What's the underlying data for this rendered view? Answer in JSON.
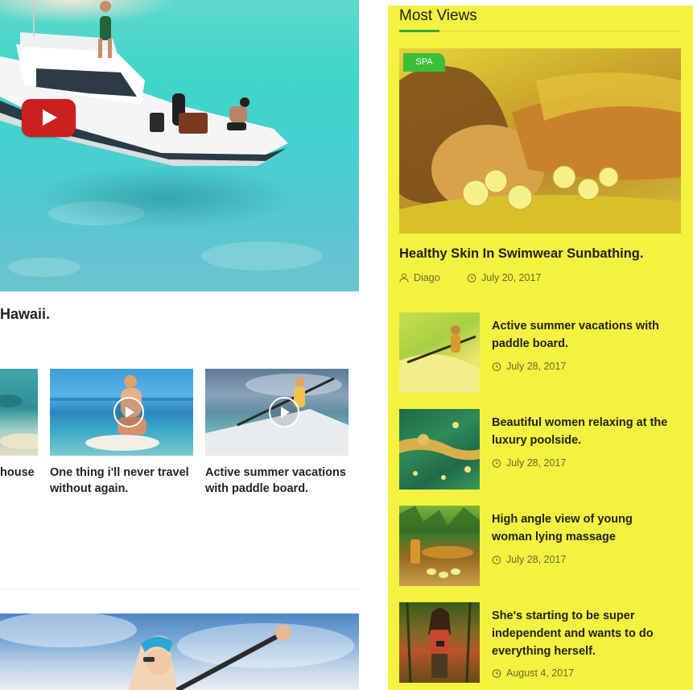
{
  "left": {
    "hero": {
      "play_label": "play"
    },
    "headline_fragment": "Hawaii.",
    "video_cards": [
      {
        "caption": "house"
      },
      {
        "caption": "One thing i'll never travel without again."
      },
      {
        "caption": "Active summer vacations with paddle board."
      }
    ]
  },
  "sidebar": {
    "title": "Most Views",
    "featured": {
      "badge": "SPA",
      "title": "Healthy Skin In Swimwear Sunbathing.",
      "author": "Diago",
      "date": "July 20, 2017"
    },
    "items": [
      {
        "title": "Active summer vacations with paddle board.",
        "date": "July 28, 2017"
      },
      {
        "title": "Beautiful women relaxing at the luxury poolside.",
        "date": "July 28, 2017"
      },
      {
        "title": "High angle view of young woman lying massage",
        "date": "July 28, 2017"
      },
      {
        "title": "She's starting to be super independent and wants to do everything herself.",
        "date": "August 4, 2017"
      }
    ]
  },
  "colors": {
    "sidebar_bg": "#f3f240",
    "accent_green": "#3ea83c",
    "badge_green": "#3bbf39",
    "youtube_red": "#cc1f1f"
  },
  "icons": {
    "author": "user-icon",
    "date": "clock-icon",
    "video": "play-icon",
    "youtube": "youtube-icon"
  }
}
